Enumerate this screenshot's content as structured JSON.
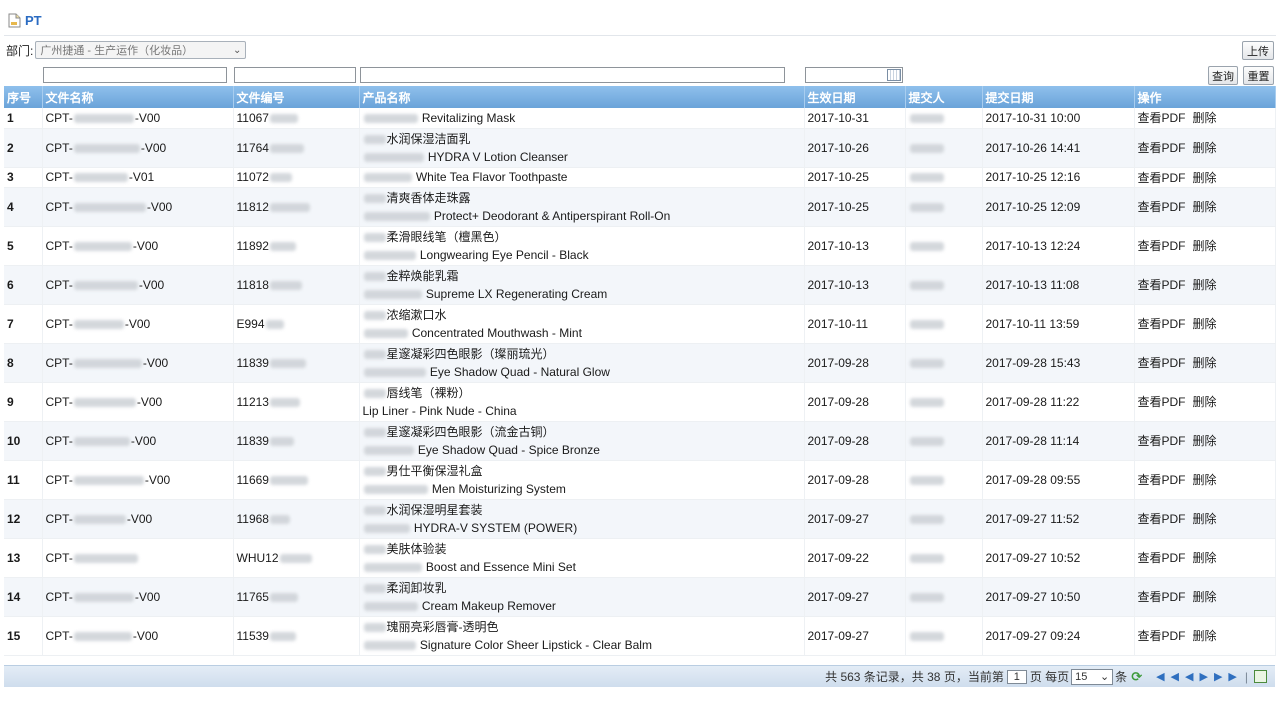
{
  "title": "PT",
  "filters": {
    "dept_label": "部门:",
    "dept_value": "广州捷通 - 生产运作（化妆品）",
    "upload_label": "上传",
    "search_label": "查询",
    "reset_label": "重置"
  },
  "columns": [
    "序号",
    "文件名称",
    "文件编号",
    "产品名称",
    "生效日期",
    "提交人",
    "提交日期",
    "操作"
  ],
  "actions": {
    "view_pdf": "查看PDF",
    "delete": "删除"
  },
  "rows": [
    {
      "seq": "1",
      "file_prefix": "CPT-",
      "file_suffix": "-V00",
      "code_prefix": "11067",
      "name_cn": "",
      "name_en": "Revitalizing Mask",
      "effective": "2017-10-31",
      "submitted": "2017-10-31 10:00"
    },
    {
      "seq": "2",
      "file_prefix": "CPT-",
      "file_suffix": "-V00",
      "code_prefix": "11764",
      "name_cn": "水润保湿洁面乳",
      "name_en": "HYDRA V Lotion Cleanser",
      "effective": "2017-10-26",
      "submitted": "2017-10-26 14:41"
    },
    {
      "seq": "3",
      "file_prefix": "CPT-",
      "file_suffix": "-V01",
      "code_prefix": "11072",
      "name_cn": "",
      "name_en": "White Tea Flavor Toothpaste",
      "effective": "2017-10-25",
      "submitted": "2017-10-25 12:16"
    },
    {
      "seq": "4",
      "file_prefix": "CPT-",
      "file_suffix": "-V00",
      "code_prefix": "11812",
      "name_cn": "清爽香体走珠露",
      "name_en": "Protect+ Deodorant & Antiperspirant Roll-On",
      "effective": "2017-10-25",
      "submitted": "2017-10-25 12:09"
    },
    {
      "seq": "5",
      "file_prefix": "CPT-",
      "file_suffix": "-V00",
      "code_prefix": "11892",
      "name_cn": "柔滑眼线笔（檀黑色）",
      "name_en": "Longwearing Eye Pencil - Black",
      "effective": "2017-10-13",
      "submitted": "2017-10-13 12:24"
    },
    {
      "seq": "6",
      "file_prefix": "CPT-",
      "file_suffix": "-V00",
      "code_prefix": "11818",
      "name_cn": "金粹焕能乳霜",
      "name_en": "Supreme LX Regenerating Cream",
      "effective": "2017-10-13",
      "submitted": "2017-10-13 11:08"
    },
    {
      "seq": "7",
      "file_prefix": "CPT-",
      "file_suffix": "-V00",
      "code_prefix": "E994",
      "name_cn": "浓缩漱口水",
      "name_en": "Concentrated Mouthwash - Mint",
      "effective": "2017-10-11",
      "submitted": "2017-10-11 13:59"
    },
    {
      "seq": "8",
      "file_prefix": "CPT-",
      "file_suffix": "-V00",
      "code_prefix": "11839",
      "name_cn": "星邃凝彩四色眼影（璨丽琉光）",
      "name_en": "Eye Shadow Quad - Natural Glow",
      "effective": "2017-09-28",
      "submitted": "2017-09-28 15:43"
    },
    {
      "seq": "9",
      "file_prefix": "CPT-",
      "file_suffix": "-V00",
      "code_prefix": "11213",
      "name_cn": "唇线笔（裸粉）",
      "name_en": "Lip Liner - Pink Nude - China",
      "effective": "2017-09-28",
      "submitted": "2017-09-28 11:22"
    },
    {
      "seq": "10",
      "file_prefix": "CPT-",
      "file_suffix": "-V00",
      "code_prefix": "11839",
      "name_cn": "星邃凝彩四色眼影（流金古铜）",
      "name_en": "Eye Shadow Quad - Spice Bronze",
      "effective": "2017-09-28",
      "submitted": "2017-09-28 11:14"
    },
    {
      "seq": "11",
      "file_prefix": "CPT-",
      "file_suffix": "-V00",
      "code_prefix": "11669",
      "name_cn": "男仕平衡保湿礼盒",
      "name_en": "Men Moisturizing System",
      "effective": "2017-09-28",
      "submitted": "2017-09-28 09:55"
    },
    {
      "seq": "12",
      "file_prefix": "CPT-",
      "file_suffix": "-V00",
      "code_prefix": "11968",
      "name_cn": "水润保湿明星套装",
      "name_en": "HYDRA-V SYSTEM (POWER)",
      "effective": "2017-09-27",
      "submitted": "2017-09-27 11:52"
    },
    {
      "seq": "13",
      "file_prefix": "CPT-",
      "file_suffix": "",
      "code_prefix": "WHU12",
      "name_cn": "美肤体验装",
      "name_en": "Boost and Essence Mini Set",
      "effective": "2017-09-22",
      "submitted": "2017-09-27 10:52"
    },
    {
      "seq": "14",
      "file_prefix": "CPT-",
      "file_suffix": "-V00",
      "code_prefix": "11765",
      "name_cn": "柔润卸妆乳",
      "name_en": "Cream Makeup Remover",
      "effective": "2017-09-27",
      "submitted": "2017-09-27 10:50"
    },
    {
      "seq": "15",
      "file_prefix": "CPT-",
      "file_suffix": "-V00",
      "code_prefix": "11539",
      "name_cn": "瑰丽亮彩唇膏-透明色",
      "name_en": "Signature Color Sheer Lipstick - Clear Balm",
      "effective": "2017-09-27",
      "submitted": "2017-09-27 09:24"
    }
  ],
  "pager": {
    "summary": "共 563 条记录，共 38 页，当前第",
    "current_page": "1",
    "per_page_label": "页 每页",
    "per_page": "15",
    "unit": "条"
  }
}
